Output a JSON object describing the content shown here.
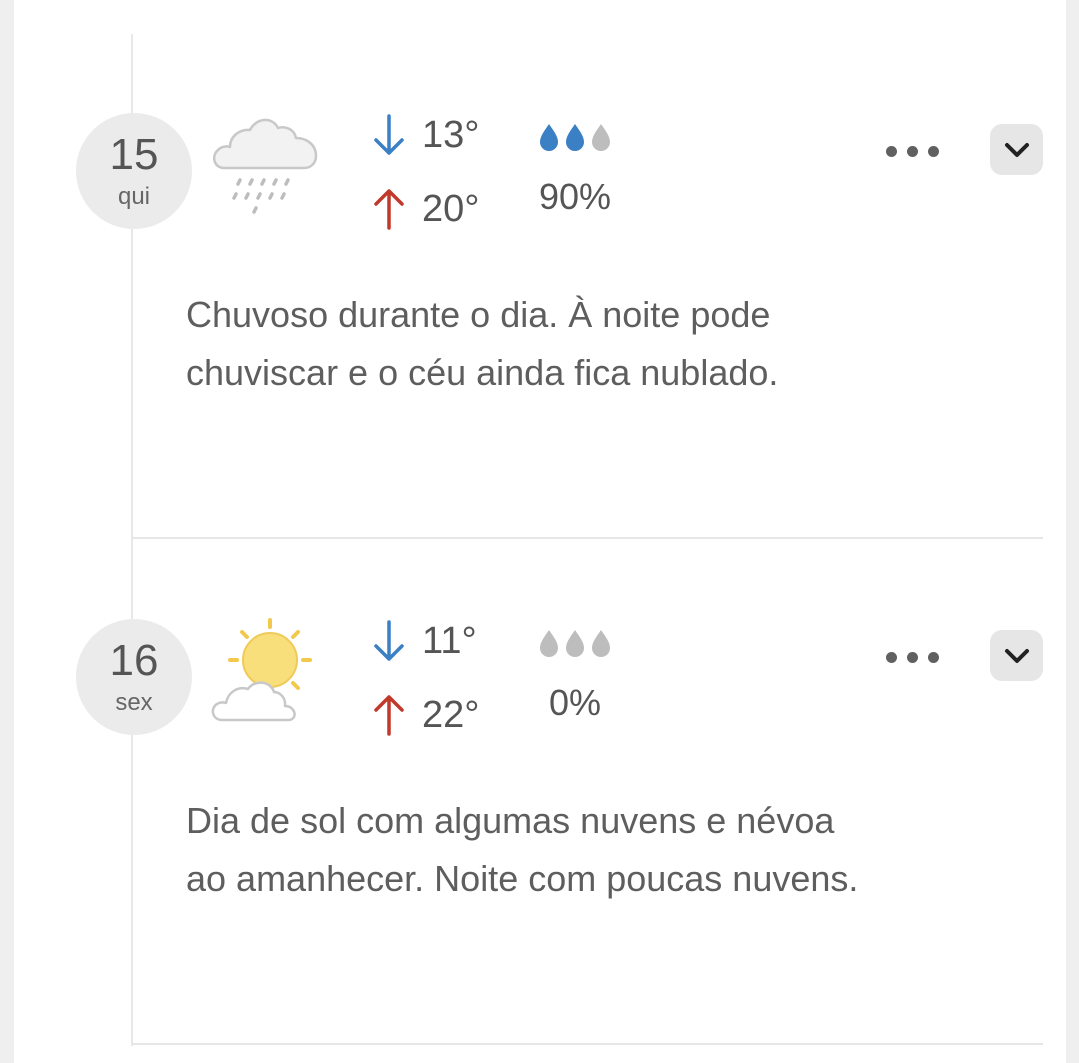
{
  "days": [
    {
      "day_number": "15",
      "weekday": "qui",
      "icon": "rain-cloud-icon",
      "temp_min": "13°",
      "temp_max": "20°",
      "rain_drops_filled": 2,
      "rain_drops_total": 3,
      "rain_chance": "90%",
      "description": "Chuvoso durante o dia. À noite pode chuviscar e o céu ainda fica nublado."
    },
    {
      "day_number": "16",
      "weekday": "sex",
      "icon": "sun-with-cloud-icon",
      "temp_min": "11°",
      "temp_max": "22°",
      "rain_drops_filled": 0,
      "rain_drops_total": 3,
      "rain_chance": "0%",
      "description": "Dia de sol com algumas nuvens e névoa ao amanhecer. Noite com poucas nuvens."
    }
  ],
  "colors": {
    "arrow_down": "#3b7fc4",
    "arrow_up": "#c0392b",
    "drop_filled": "#3b7fc4",
    "drop_empty": "#bdbdbd",
    "sun": "#f9df7b",
    "cloud_outline": "#c8c8c8"
  }
}
